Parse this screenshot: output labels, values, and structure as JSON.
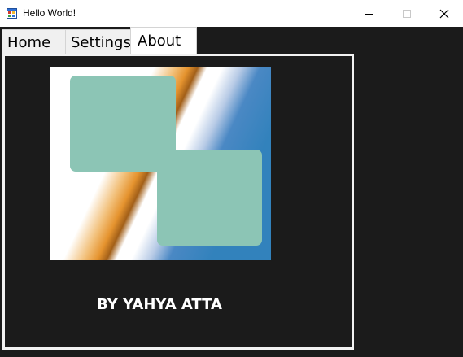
{
  "window": {
    "title": "Hello World!",
    "icon": "app-window-icon",
    "controls": {
      "minimize_icon": "minimize-icon",
      "maximize_icon": "maximize-icon",
      "close_icon": "close-icon"
    }
  },
  "tabs": [
    {
      "label": "Home",
      "selected": false
    },
    {
      "label": "Settings",
      "selected": false
    },
    {
      "label": "About",
      "selected": true
    }
  ],
  "about": {
    "logo": "two-teal-rounded-squares-on-diagonal-gradient",
    "author": "BY YAHYA ATTA"
  },
  "colors": {
    "background": "#1b1b1b",
    "panel_border": "#f2f2f2",
    "logo_squares": "#8cc5b5",
    "logo_blue": "#3282bc",
    "logo_orange": "#e5932e",
    "text": "#ffffff"
  }
}
